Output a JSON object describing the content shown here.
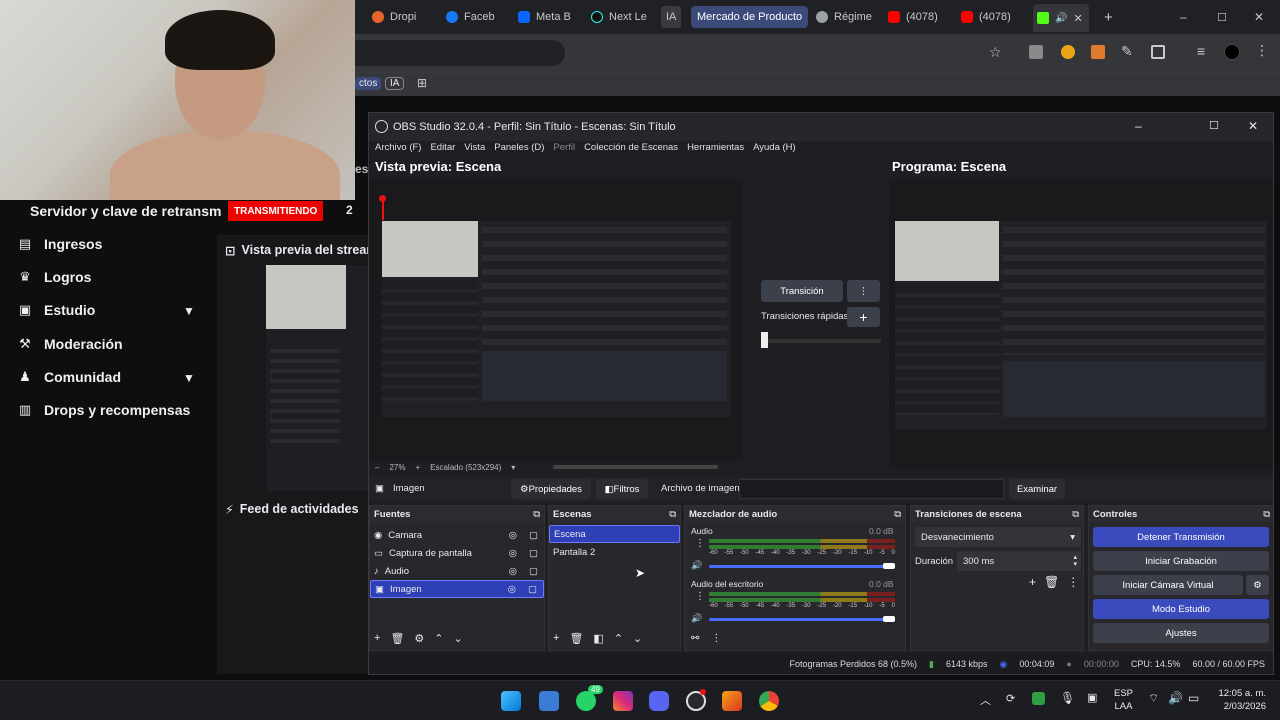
{
  "browser": {
    "tabs": [
      "Dropi",
      "Faceb",
      "Meta B",
      "Next Le",
      "IA",
      "Mercado de Producto",
      "Régime",
      "(4078)",
      "(4078)"
    ],
    "bookmark_fragment": "ctos",
    "bookmark_ia": "IA",
    "window_controls": [
      "–",
      "☐",
      "✕"
    ],
    "new_tab": "+"
  },
  "twitch": {
    "stream_key_label": "Servidor y clave de retransm",
    "live_badge": "TRANSMITIENDO",
    "count": "2",
    "nav": [
      "Ingresos",
      "Logros",
      "Estudio",
      "Moderación",
      "Comunidad",
      "Drops y recompensas"
    ],
    "preview_title": "Vista previa del stream",
    "feed_title": "Feed de actividades",
    "fragment_esi": "esi"
  },
  "obs": {
    "title": "OBS Studio 32.0.4 - Perfil: Sin Título - Escenas: Sin Título",
    "menu": [
      "Archivo (F)",
      "Editar",
      "Vista",
      "Paneles (D)",
      "Perfil",
      "Colección de Escenas",
      "Herramientas",
      "Ayuda (H)"
    ],
    "preview_label": "Vista previa: Escena",
    "program_label": "Programa: Escena",
    "transition_btn": "Transición",
    "quick_transitions": "Transiciones rápidas",
    "zoom": "27%",
    "scaled": "Escalado (523x294)",
    "source_name": "Imagen",
    "properties": "Propiedades",
    "filters": "Filtros",
    "image_file": "Archivo de imagen",
    "browse": "Examinar",
    "sources": {
      "title": "Fuentes",
      "items": [
        "Camara",
        "Captura de pantalla",
        "Audio",
        "Imagen"
      ]
    },
    "scenes": {
      "title": "Escenas",
      "items": [
        "Escena",
        "Pantalla 2"
      ]
    },
    "mixer": {
      "title": "Mezclador de audio",
      "channels": [
        {
          "name": "Audio",
          "db": "0.0 dB"
        },
        {
          "name": "Audio del escritorio",
          "db": "0.0 dB"
        }
      ],
      "scale": [
        "-60",
        "-55",
        "-50",
        "-45",
        "-40",
        "-35",
        "-30",
        "-25",
        "-20",
        "-15",
        "-10",
        "-5",
        "0"
      ]
    },
    "transitions": {
      "title": "Transiciones de escena",
      "selected": "Desvanecimiento",
      "duration_label": "Duración",
      "duration_value": "300 ms"
    },
    "controls": {
      "title": "Controles",
      "buttons": [
        "Detener Transmisión",
        "Iniciar Grabación",
        "Iniciar Cámara Virtual",
        "Modo Estudio",
        "Ajustes"
      ]
    },
    "status": {
      "dropped": "Fotogramas Perdidos 68 (0.5%)",
      "bitrate": "6143 kbps",
      "stream_time": "00:04:09",
      "rec_time": "00:00:00",
      "cpu": "CPU: 14.5%",
      "fps": "60.00 / 60.00 FPS"
    }
  },
  "taskbar": {
    "whatsapp_badge": "49",
    "lang": "ESP",
    "lang2": "LAA",
    "time": "12:05 a. m.",
    "date": "2/03/2026"
  }
}
